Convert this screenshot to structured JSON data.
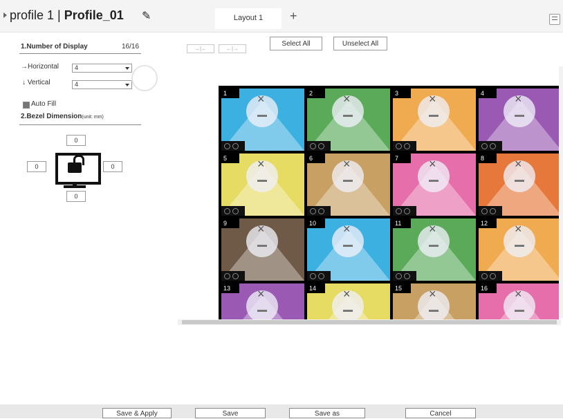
{
  "header": {
    "profile_prefix": "profile 1 | ",
    "profile_name": "Profile_01",
    "tab_label": "Layout 1",
    "add_tab_label": "+"
  },
  "display": {
    "section_title": "1.Number of Display",
    "count": "16/16",
    "horizontal_label": "Horizontal",
    "horizontal_value": "4",
    "vertical_label": "Vertical",
    "vertical_value": "4",
    "auto_fill_label": "Auto Fill",
    "auto_fill_checked": true
  },
  "bezel": {
    "section_title": "2.Bezel Dimension",
    "unit_note": "(unit: mm)",
    "top": "0",
    "left": "0",
    "right": "0",
    "bottom": "0"
  },
  "toolbar": {
    "select_all": "Select All",
    "unselect_all": "Unselect All"
  },
  "grid": {
    "cells": [
      {
        "num": "1",
        "color": "#3cb0e0"
      },
      {
        "num": "2",
        "color": "#5aaa5a"
      },
      {
        "num": "3",
        "color": "#f0aa50"
      },
      {
        "num": "4",
        "color": "#9a5ab4"
      },
      {
        "num": "5",
        "color": "#e6dc64"
      },
      {
        "num": "6",
        "color": "#c8a064"
      },
      {
        "num": "7",
        "color": "#e66eaa"
      },
      {
        "num": "8",
        "color": "#e6783c"
      },
      {
        "num": "9",
        "color": "#6e5a46"
      },
      {
        "num": "10",
        "color": "#3cb0e0"
      },
      {
        "num": "11",
        "color": "#5aaa5a"
      },
      {
        "num": "12",
        "color": "#f0aa50"
      },
      {
        "num": "13",
        "color": "#9a5ab4"
      },
      {
        "num": "14",
        "color": "#e6dc64"
      },
      {
        "num": "15",
        "color": "#c8a064"
      },
      {
        "num": "16",
        "color": "#e66eaa"
      }
    ]
  },
  "footer": {
    "save_apply": "Save & Apply",
    "save": "Save",
    "save_as": "Save as",
    "cancel": "Cancel"
  }
}
